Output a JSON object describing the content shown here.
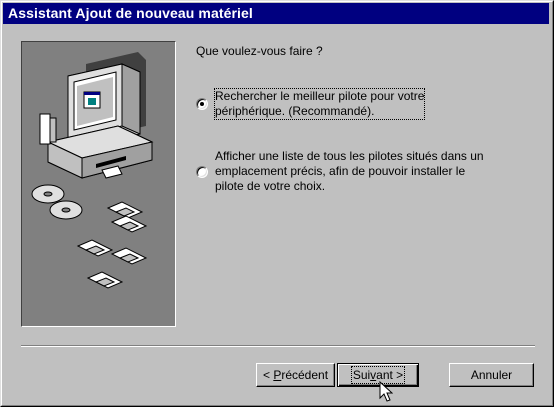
{
  "window": {
    "title": "Assistant Ajout de nouveau matériel"
  },
  "content": {
    "prompt": "Que voulez-vous faire ?",
    "options": [
      {
        "line1": "Rechercher le meilleur pilote pour votre",
        "line2": "périphérique. (Recommandé).",
        "selected": true
      },
      {
        "line1": "Afficher une liste de tous les pilotes situés dans un",
        "line2": "emplacement précis, afin de pouvoir installer le",
        "line3": "pilote de votre choix.",
        "selected": false
      }
    ]
  },
  "buttons": {
    "back_prefix": "< ",
    "back_accel": "P",
    "back_rest": "récédent",
    "next_prefix": "Sui",
    "next_accel": "v",
    "next_rest": "ant >",
    "cancel": "Annuler"
  },
  "icons": {
    "illustration": "hardware-wizard-illustration",
    "cursor": "arrow-cursor-icon"
  },
  "colors": {
    "titlebar": "#000080",
    "face": "#c0c0c0",
    "illustration_bg": "#808080"
  }
}
